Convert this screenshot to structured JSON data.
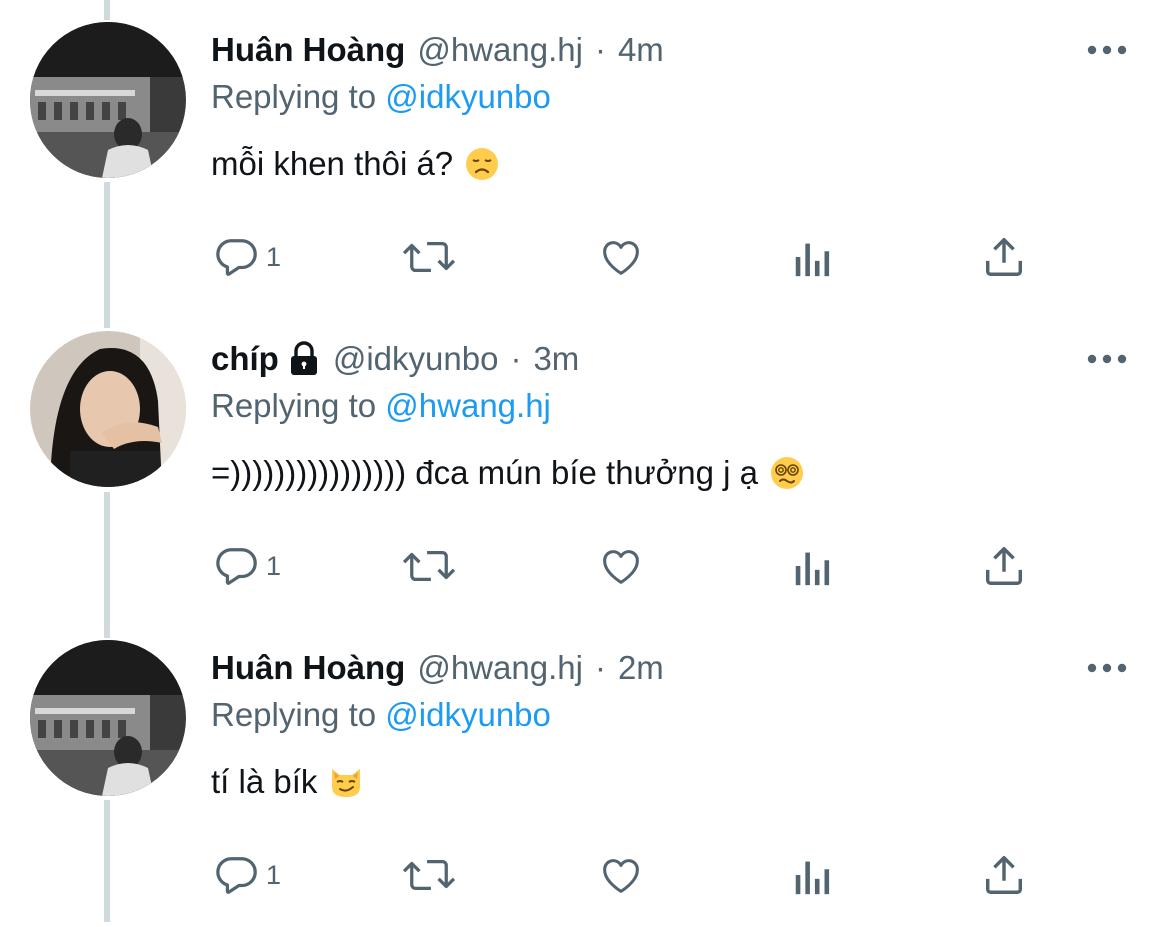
{
  "tweets": [
    {
      "display_name": "Huân Hoàng",
      "handle": "@hwang.hj",
      "separator": "·",
      "time": "4m",
      "replying_prefix": "Replying to",
      "replying_to": "@idkyunbo",
      "text": "mỗi khen thôi á?",
      "emoji": "disappointed-face",
      "reply_count": "1",
      "locked": false
    },
    {
      "display_name": "chíp",
      "handle": "@idkyunbo",
      "separator": "·",
      "time": "3m",
      "replying_prefix": "Replying to",
      "replying_to": "@hwang.hj",
      "text": "=)))))))))))))))) đca mún bíe thưởng j ạ",
      "emoji": "dizzy-face",
      "reply_count": "1",
      "locked": true
    },
    {
      "display_name": "Huân Hoàng",
      "handle": "@hwang.hj",
      "separator": "·",
      "time": "2m",
      "replying_prefix": "Replying to",
      "replying_to": "@idkyunbo",
      "text": "tí là bík",
      "emoji": "smirking-cat-face",
      "reply_count": "1",
      "locked": false
    }
  ],
  "icons": [
    "reply-icon",
    "retweet-icon",
    "like-icon",
    "analytics-icon",
    "share-icon",
    "more-icon",
    "lock-icon"
  ],
  "colors": {
    "text": "#0f1419",
    "secondary": "#536471",
    "link": "#1d9bf0",
    "thread_line": "#cfd9de"
  }
}
